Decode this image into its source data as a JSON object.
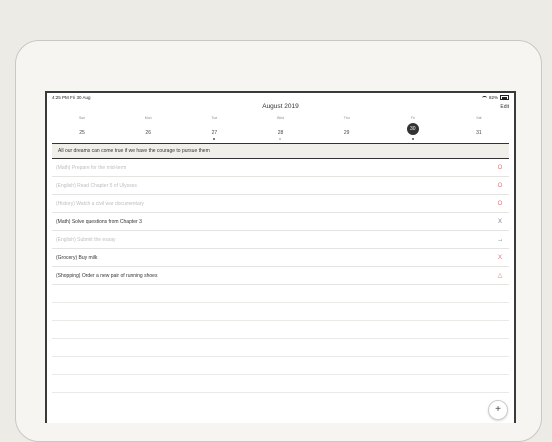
{
  "status": {
    "time": "4:25 PM",
    "date": "Fri 30 Aug",
    "battery": "82%"
  },
  "header": {
    "month": "August 2019",
    "edit_label": "Edit"
  },
  "week": [
    {
      "dow": "Sun",
      "date": "25",
      "dot": ""
    },
    {
      "dow": "Mon",
      "date": "26",
      "dot": ""
    },
    {
      "dow": "Tue",
      "date": "27",
      "dot": "dark"
    },
    {
      "dow": "Wed",
      "date": "28",
      "dot": "light"
    },
    {
      "dow": "Thu",
      "date": "29",
      "dot": ""
    },
    {
      "dow": "Fri",
      "date": "30",
      "dot": "dark",
      "selected": true
    },
    {
      "dow": "Sat",
      "date": "31",
      "dot": ""
    }
  ],
  "quote": "All our dreams can come true if we have the courage to pursue them",
  "tasks": [
    {
      "text": "(Math) Prepare for the mid-term",
      "mark": "O",
      "done": true,
      "mark_icon": "circle-icon"
    },
    {
      "text": "(English) Read Chapter 5 of Ulysses",
      "mark": "O",
      "done": true,
      "mark_icon": "circle-icon"
    },
    {
      "text": "(History) Watch a civil war documentary",
      "mark": "O",
      "done": true,
      "mark_icon": "circle-icon"
    },
    {
      "text": "(Math) Solve questions from Chapter 3",
      "mark": "X",
      "done": false,
      "mark_icon": "x-icon-grey"
    },
    {
      "text": "(English) Submit the essay",
      "mark": "→",
      "done": true,
      "mark_icon": "arrow-icon"
    },
    {
      "text": "(Grocery) Buy milk",
      "mark": "X",
      "done": false,
      "mark_icon": "x-icon"
    },
    {
      "text": "(Shopping) Order a new pair of running shoes",
      "mark": "△",
      "done": false,
      "mark_icon": "triangle-icon"
    }
  ],
  "fab_label": "+",
  "colors": {
    "accent": "#e07070",
    "selected_day": "#333333"
  }
}
